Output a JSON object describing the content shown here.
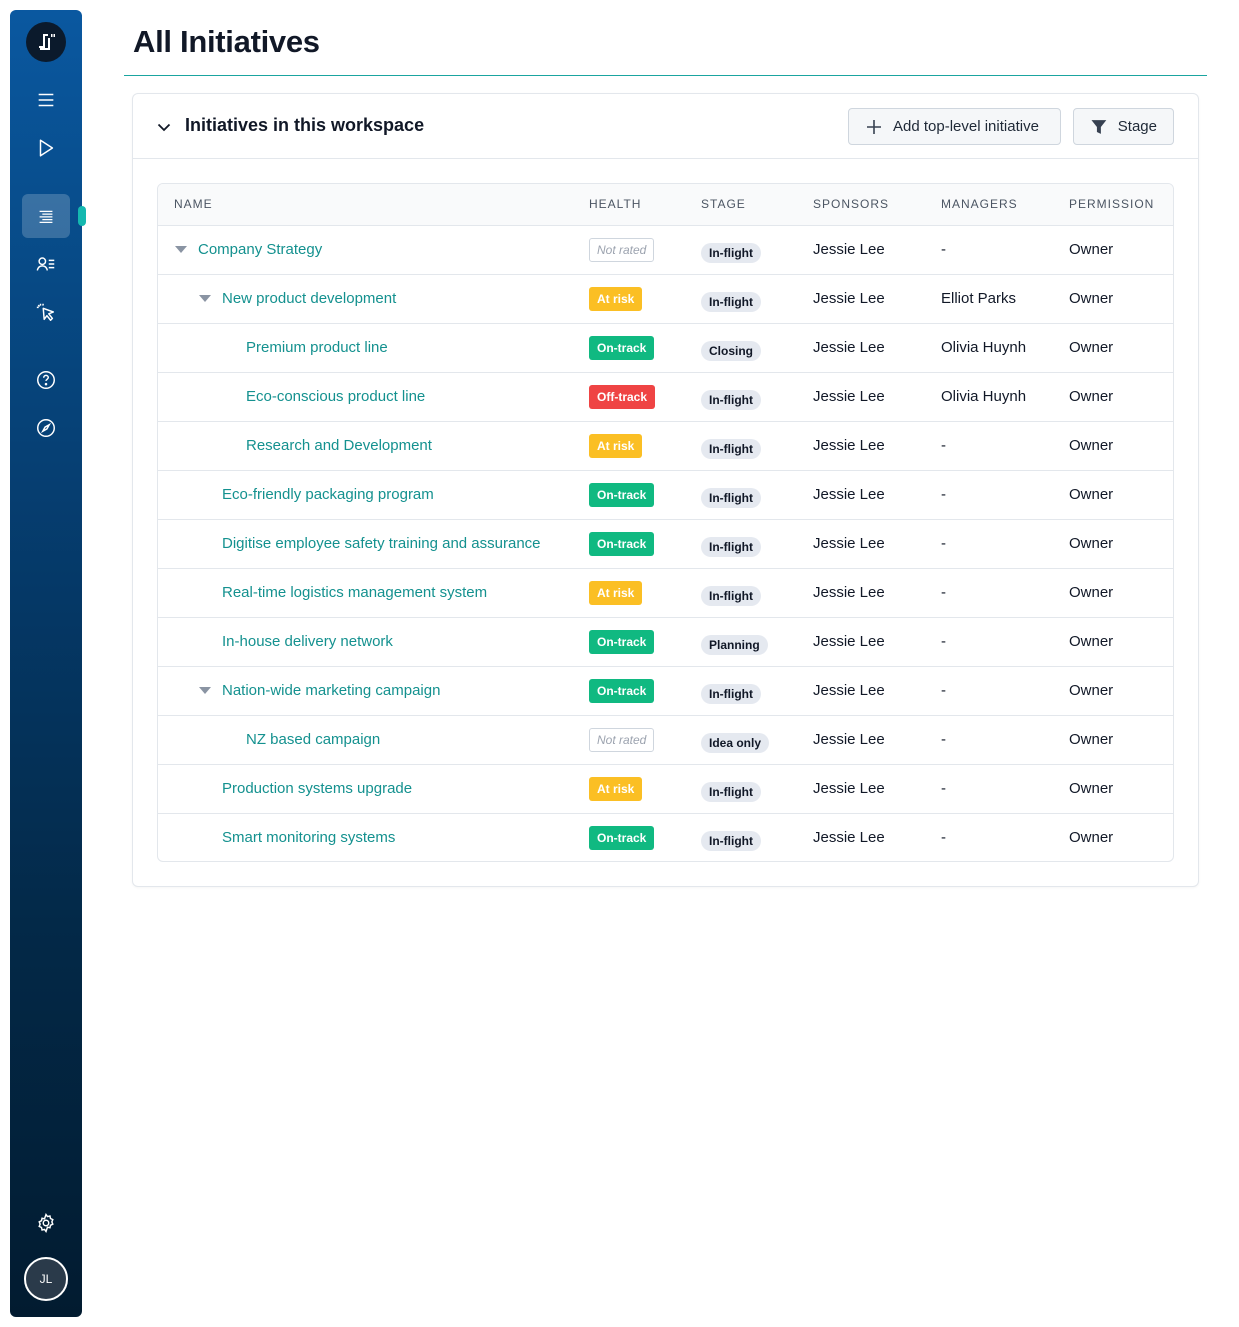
{
  "sidebar": {
    "logo": "logo-icon",
    "items": [
      {
        "name": "menu",
        "icon": "hamburger-icon"
      },
      {
        "name": "play",
        "icon": "play-icon"
      },
      {
        "name": "initiatives",
        "icon": "list-icon",
        "active": true
      },
      {
        "name": "people",
        "icon": "people-list-icon"
      },
      {
        "name": "select",
        "icon": "cursor-click-icon"
      },
      {
        "name": "help",
        "icon": "help-circle-icon"
      },
      {
        "name": "explore",
        "icon": "compass-icon"
      },
      {
        "name": "settings",
        "icon": "gear-icon"
      }
    ],
    "avatar_initials": "JL"
  },
  "page": {
    "title": "All Initiatives"
  },
  "panel": {
    "title": "Initiatives in this workspace",
    "add_button_label": "Add top-level initiative",
    "stage_button_label": "Stage"
  },
  "colors": {
    "accent": "#14918f",
    "on_track": "#10b981",
    "at_risk": "#fbbf24",
    "off_track": "#ef4444"
  },
  "table": {
    "columns": [
      "NAME",
      "HEALTH",
      "STAGE",
      "SPONSORS",
      "MANAGERS",
      "PERMISSION"
    ],
    "rows": [
      {
        "name": "Company Strategy",
        "level": 0,
        "expandable": true,
        "health": "Not rated",
        "stage": "In-flight",
        "sponsor": "Jessie Lee",
        "manager": "-",
        "permission": "Owner"
      },
      {
        "name": "New product development",
        "level": 1,
        "expandable": true,
        "health": "At risk",
        "stage": "In-flight",
        "sponsor": "Jessie Lee",
        "manager": "Elliot Parks",
        "permission": "Owner"
      },
      {
        "name": "Premium product line",
        "level": 2,
        "expandable": false,
        "health": "On-track",
        "stage": "Closing",
        "sponsor": "Jessie Lee",
        "manager": "Olivia Huynh",
        "permission": "Owner"
      },
      {
        "name": "Eco-conscious product line",
        "level": 2,
        "expandable": false,
        "health": "Off-track",
        "stage": "In-flight",
        "sponsor": "Jessie Lee",
        "manager": "Olivia Huynh",
        "permission": "Owner"
      },
      {
        "name": "Research and Development",
        "level": 2,
        "expandable": false,
        "health": "At risk",
        "stage": "In-flight",
        "sponsor": "Jessie Lee",
        "manager": "-",
        "permission": "Owner"
      },
      {
        "name": "Eco-friendly packaging program",
        "level": 1,
        "expandable": false,
        "health": "On-track",
        "stage": "In-flight",
        "sponsor": "Jessie Lee",
        "manager": "-",
        "permission": "Owner"
      },
      {
        "name": "Digitise employee safety training and assurance",
        "level": 1,
        "expandable": false,
        "health": "On-track",
        "stage": "In-flight",
        "sponsor": "Jessie Lee",
        "manager": "-",
        "permission": "Owner"
      },
      {
        "name": "Real-time logistics management system",
        "level": 1,
        "expandable": false,
        "health": "At risk",
        "stage": "In-flight",
        "sponsor": "Jessie Lee",
        "manager": "-",
        "permission": "Owner"
      },
      {
        "name": "In-house delivery network",
        "level": 1,
        "expandable": false,
        "health": "On-track",
        "stage": "Planning",
        "sponsor": "Jessie Lee",
        "manager": "-",
        "permission": "Owner"
      },
      {
        "name": "Nation-wide marketing campaign",
        "level": 1,
        "expandable": true,
        "health": "On-track",
        "stage": "In-flight",
        "sponsor": "Jessie Lee",
        "manager": "-",
        "permission": "Owner"
      },
      {
        "name": "NZ based campaign",
        "level": 2,
        "expandable": false,
        "health": "Not rated",
        "stage": "Idea only",
        "sponsor": "Jessie Lee",
        "manager": "-",
        "permission": "Owner"
      },
      {
        "name": "Production systems upgrade",
        "level": 1,
        "expandable": false,
        "health": "At risk",
        "stage": "In-flight",
        "sponsor": "Jessie Lee",
        "manager": "-",
        "permission": "Owner"
      },
      {
        "name": "Smart monitoring systems",
        "level": 1,
        "expandable": false,
        "health": "On-track",
        "stage": "In-flight",
        "sponsor": "Jessie Lee",
        "manager": "-",
        "permission": "Owner"
      }
    ]
  }
}
